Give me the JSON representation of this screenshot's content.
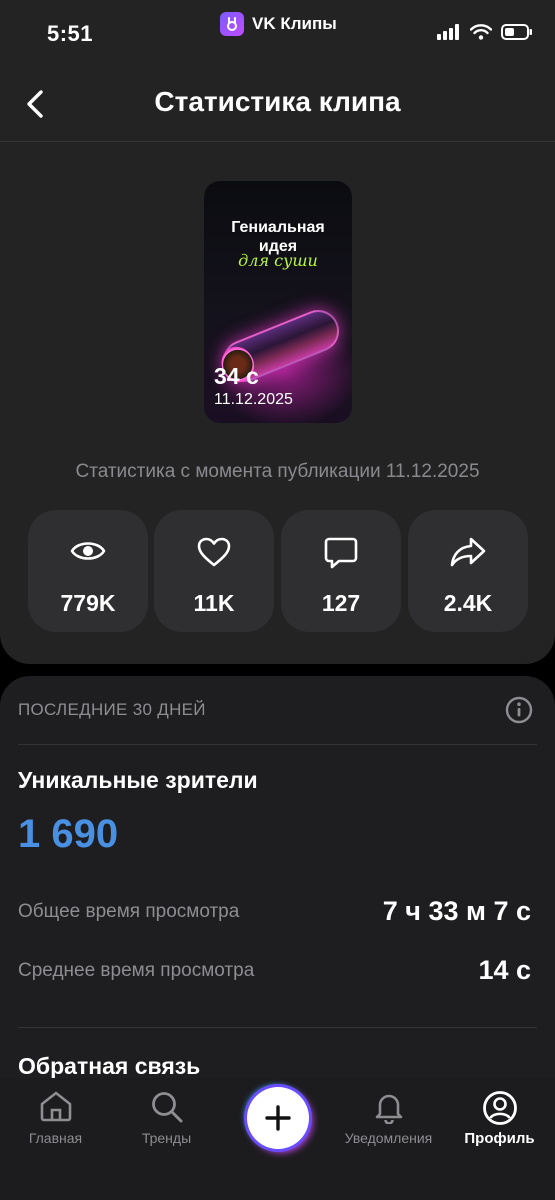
{
  "status_bar": {
    "time": "5:51",
    "app_name": "VK Клипы"
  },
  "header": {
    "title": "Статистика клипа"
  },
  "clip": {
    "headline_line1": "Гениальная",
    "headline_line2": "идея",
    "headline_script": "для суши",
    "duration": "34 с",
    "date": "11.12.2025"
  },
  "stats_caption": "Статистика с момента публикации 11.12.2025",
  "stats": [
    {
      "icon": "eye-icon",
      "value": "779K"
    },
    {
      "icon": "heart-icon",
      "value": "11K"
    },
    {
      "icon": "comment-icon",
      "value": "127"
    },
    {
      "icon": "share-icon",
      "value": "2.4K"
    }
  ],
  "period": {
    "header": "ПОСЛЕДНИЕ 30 ДНЕЙ",
    "unique_viewers_label": "Уникальные зрители",
    "unique_viewers_value": "1 690",
    "rows": [
      {
        "label": "Общее время просмотра",
        "value": "7 ч 33 м 7 с"
      },
      {
        "label": "Среднее время просмотра",
        "value": "14 с"
      }
    ],
    "feedback_title": "Обратная связь"
  },
  "tab_bar": {
    "items": [
      {
        "label": "Главная",
        "icon": "home-icon"
      },
      {
        "label": "Тренды",
        "icon": "search-icon"
      },
      {
        "label": "",
        "icon": "plus-icon"
      },
      {
        "label": "Уведомления",
        "icon": "bell-icon"
      },
      {
        "label": "Профиль",
        "icon": "profile-icon",
        "active": true
      }
    ]
  },
  "colors": {
    "accent_blue": "#4a90e2",
    "card_bg": "#232324",
    "tile_bg": "#2f2f31",
    "muted_text": "#8d8d92"
  }
}
